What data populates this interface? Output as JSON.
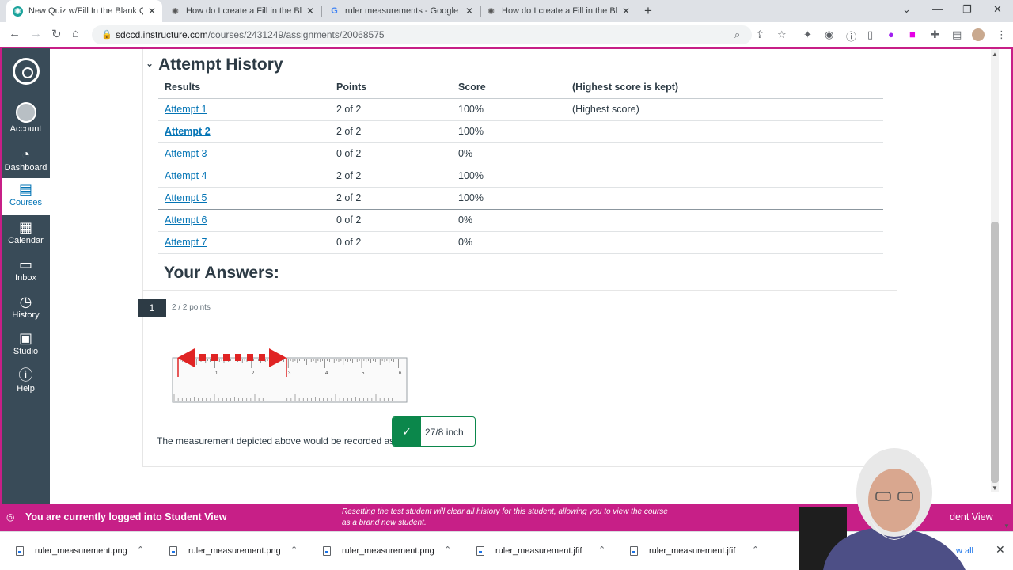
{
  "browser": {
    "tabs": [
      {
        "title": "New Quiz w/Fill In the Blank Que",
        "icon": "canvas-icon",
        "active": true
      },
      {
        "title": "How do I create a Fill in the Blank",
        "icon": "canvas-icon",
        "active": false
      },
      {
        "title": "ruler measurements - Google Se",
        "icon": "google-icon",
        "active": false
      },
      {
        "title": "How do I create a Fill in the Blank",
        "icon": "canvas-icon",
        "active": false
      }
    ],
    "url_host": "sdccd.instructure.com",
    "url_path": "/courses/2431249/assignments/20068575"
  },
  "gnav": {
    "items": [
      {
        "label": "Account",
        "icon": "avatar-icon"
      },
      {
        "label": "Dashboard",
        "icon": "dashboard-icon"
      },
      {
        "label": "Courses",
        "icon": "courses-icon",
        "active": true
      },
      {
        "label": "Calendar",
        "icon": "calendar-icon"
      },
      {
        "label": "Inbox",
        "icon": "inbox-icon"
      },
      {
        "label": "History",
        "icon": "history-icon"
      },
      {
        "label": "Studio",
        "icon": "studio-icon"
      },
      {
        "label": "Help",
        "icon": "help-icon"
      }
    ]
  },
  "attempt_history": {
    "title": "Attempt History",
    "headers": [
      "Results",
      "Points",
      "Score",
      "(Highest score is kept)"
    ],
    "rows": [
      {
        "attempt": "Attempt 1",
        "points": "2 of 2",
        "score": "100%",
        "note": "(Highest score)"
      },
      {
        "attempt": "Attempt 2",
        "points": "2 of 2",
        "score": "100%",
        "note": ""
      },
      {
        "attempt": "Attempt 3",
        "points": "0 of 2",
        "score": "0%",
        "note": ""
      },
      {
        "attempt": "Attempt 4",
        "points": "2 of 2",
        "score": "100%",
        "note": ""
      },
      {
        "attempt": "Attempt 5",
        "points": "2 of 2",
        "score": "100%",
        "note": ""
      },
      {
        "attempt": "Attempt 6",
        "points": "0 of 2",
        "score": "0%",
        "note": ""
      },
      {
        "attempt": "Attempt 7",
        "points": "0 of 2",
        "score": "0%",
        "note": ""
      }
    ]
  },
  "answers": {
    "title": "Your Answers:",
    "question_number": "1",
    "points": "2 / 2 points",
    "question_text": "The measurement depicted above would be recorded as",
    "answer_value": "27/8 inch",
    "ruler_inch_labels": [
      "1",
      "2",
      "3",
      "4",
      "5",
      "6"
    ]
  },
  "student_view": {
    "message": "You are currently logged into Student View",
    "info": "Resetting the test student will clear all history for this student, allowing you to view the course as a brand new student.",
    "leave_label": "dent View"
  },
  "downloads": {
    "items": [
      "ruler_measurement.png",
      "ruler_measurement.png",
      "ruler_measurement.png",
      "ruler_measurement.jfif",
      "ruler_measurement.jfif"
    ],
    "show_all": "w all"
  },
  "colors": {
    "canvas_nav": "#394b58",
    "student_view": "#c71f87",
    "link": "#0374b5",
    "correct": "#0b874b"
  }
}
